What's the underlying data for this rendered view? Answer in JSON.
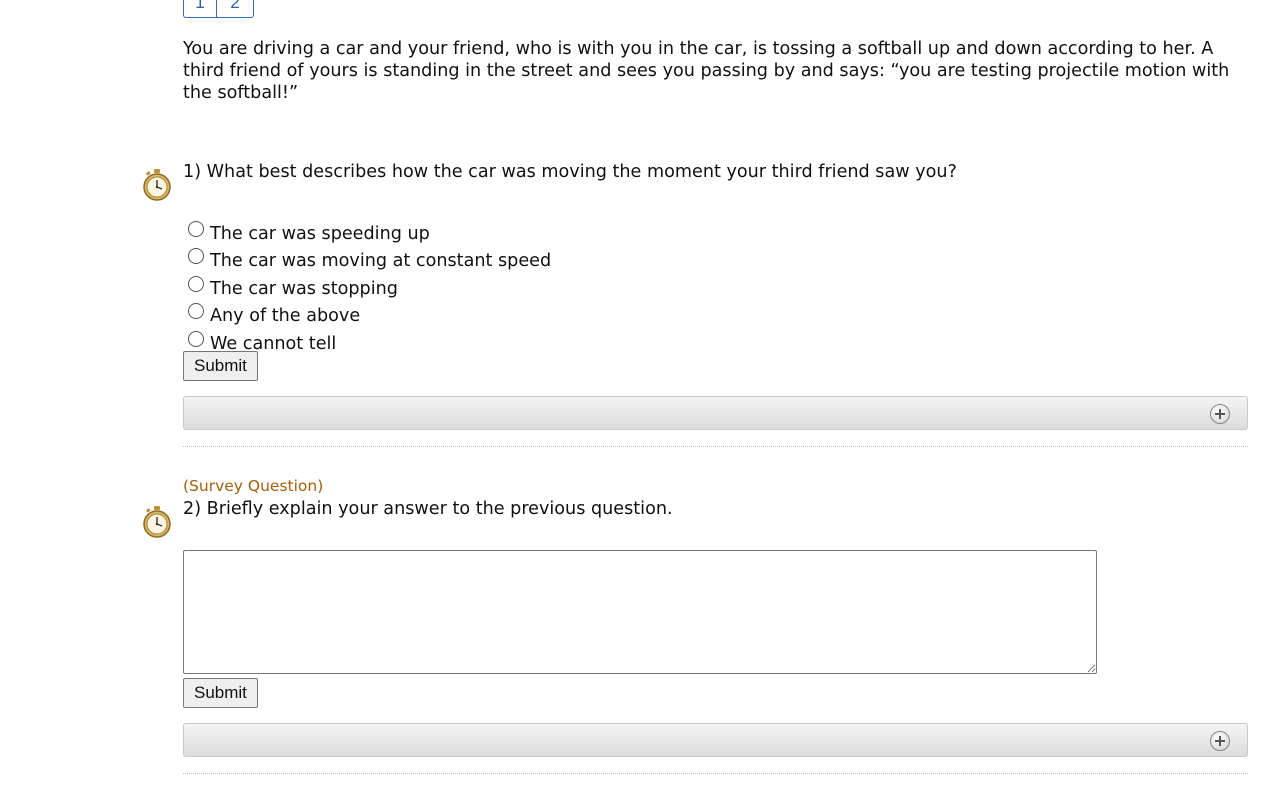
{
  "pager": {
    "pages": [
      "1",
      "2"
    ]
  },
  "intro": "You are driving a car and your friend, who is with you in the car, is tossing a softball up and down according to her.  A third friend of yours is standing in the street and sees you passing by and says: “you are testing projectile motion with the softball!”",
  "questions": [
    {
      "number": "1)",
      "text": "1) What best describes how the car was moving the moment your third friend saw you?",
      "options": [
        "The car was speeding up",
        "The car was moving at constant speed",
        "The car was stopping",
        "Any of the above",
        "We cannot tell"
      ],
      "submit_label": "Submit"
    },
    {
      "tag": "(Survey Question)",
      "text": "2) Briefly explain your answer to the previous question.",
      "answer_value": "",
      "submit_label": "Submit"
    }
  ],
  "icons": {
    "timer": "stopwatch-icon",
    "expand": "plus-circle-icon"
  },
  "colors": {
    "survey_tag": "#a3600b",
    "pager_border": "#3a6db0"
  }
}
